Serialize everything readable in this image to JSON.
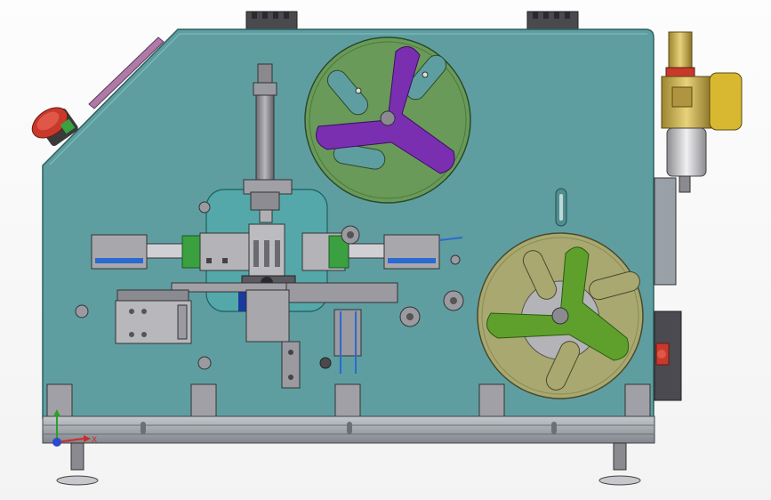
{
  "viewport": {
    "background": "#f7f7f7",
    "colors": {
      "panel": "#5f9ea0",
      "panel_edge": "#2f5f60",
      "frame": "#9aa0a8",
      "metal": "#a8a8ac",
      "metal_dark": "#6f6f74",
      "reel_upper_disc": "#6a9a5a",
      "reel_upper_hub": "#7a2fb0",
      "reel_lower_disc": "#a8a870",
      "reel_lower_hub": "#5fa02c",
      "estop_red": "#c8392b",
      "regulator_brass": "#c8b058",
      "regulator_gold": "#d8b830",
      "cylinder_green": "#3aa040",
      "accent_blue": "#2a6ad0"
    },
    "icons": [
      "emergency-stop-icon",
      "pressure-regulator-icon",
      "triad-x-axis-icon",
      "triad-y-axis-icon",
      "triad-z-axis-icon"
    ]
  },
  "triad": {
    "x_label": "X"
  }
}
